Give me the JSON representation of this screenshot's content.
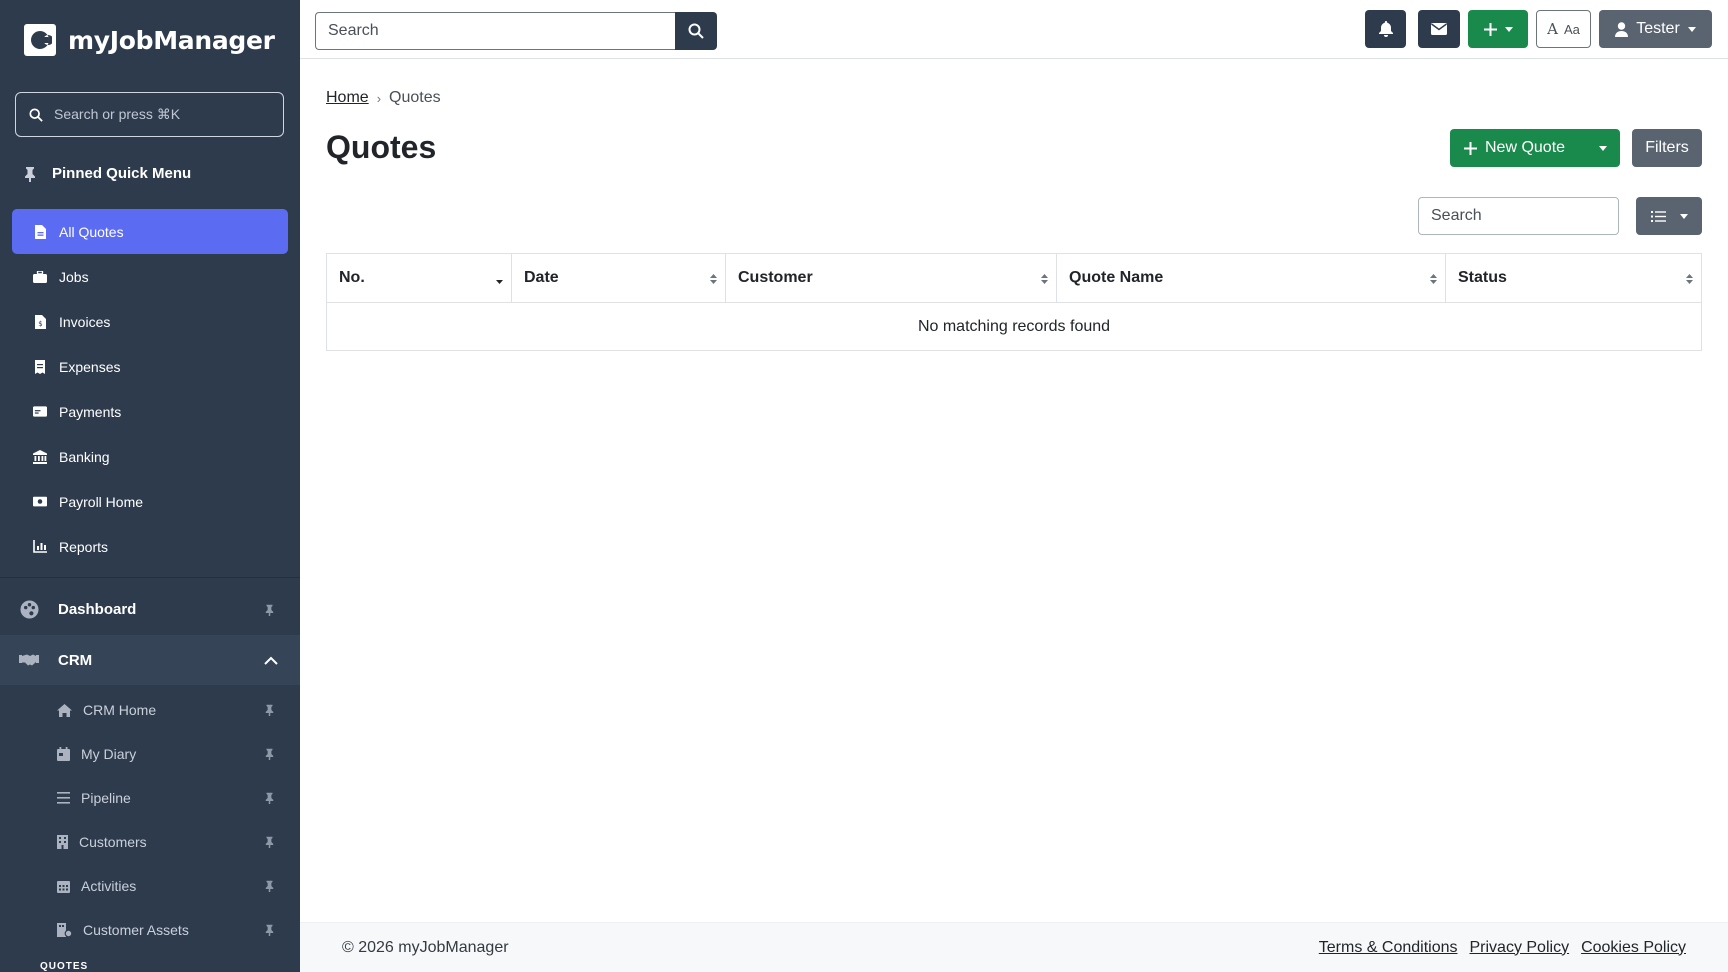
{
  "brand": {
    "name": "myJobManager"
  },
  "sidebar": {
    "search_placeholder": "Search or press ⌘K",
    "pinned_title": "Pinned Quick Menu",
    "quick_items": [
      {
        "label": "All Quotes",
        "icon": "file-icon",
        "active": true
      },
      {
        "label": "Jobs",
        "icon": "briefcase-icon"
      },
      {
        "label": "Invoices",
        "icon": "invoice-icon"
      },
      {
        "label": "Expenses",
        "icon": "receipt-icon"
      },
      {
        "label": "Payments",
        "icon": "card-icon"
      },
      {
        "label": "Banking",
        "icon": "bank-icon"
      },
      {
        "label": "Payroll Home",
        "icon": "money-icon"
      },
      {
        "label": "Reports",
        "icon": "chart-icon"
      }
    ],
    "sections": {
      "dashboard": {
        "label": "Dashboard",
        "icon": "palette-icon"
      },
      "crm": {
        "label": "CRM",
        "icon": "handshake-icon",
        "expanded": true
      }
    },
    "crm_items": [
      {
        "label": "CRM Home",
        "icon": "home-icon"
      },
      {
        "label": "My Diary",
        "icon": "calendar-icon"
      },
      {
        "label": "Pipeline",
        "icon": "lines-icon"
      },
      {
        "label": "Customers",
        "icon": "building-icon"
      },
      {
        "label": "Activities",
        "icon": "calendar-grid-icon"
      },
      {
        "label": "Customer Assets",
        "icon": "assets-icon"
      }
    ],
    "quotes_heading": "QUOTES"
  },
  "topbar": {
    "search_placeholder": "Search",
    "user_label": "Tester",
    "font_toggle": {
      "a1": "A",
      "a2": "Aa"
    }
  },
  "breadcrumb": {
    "home": "Home",
    "current": "Quotes"
  },
  "page": {
    "title": "Quotes",
    "new_quote_label": "New Quote",
    "filters_label": "Filters",
    "table_search_placeholder": "Search"
  },
  "table": {
    "columns": [
      "No.",
      "Date",
      "Customer",
      "Quote Name",
      "Status"
    ],
    "empty_message": "No matching records found"
  },
  "footer": {
    "copyright": "© 2026 myJobManager",
    "links": [
      "Terms & Conditions",
      "Privacy Policy",
      "Cookies Policy"
    ]
  },
  "colors": {
    "sidebar_bg": "#2e3b4d",
    "active_item": "#5b6cf2",
    "success": "#1a8a4c",
    "secondary": "#5a6470"
  }
}
